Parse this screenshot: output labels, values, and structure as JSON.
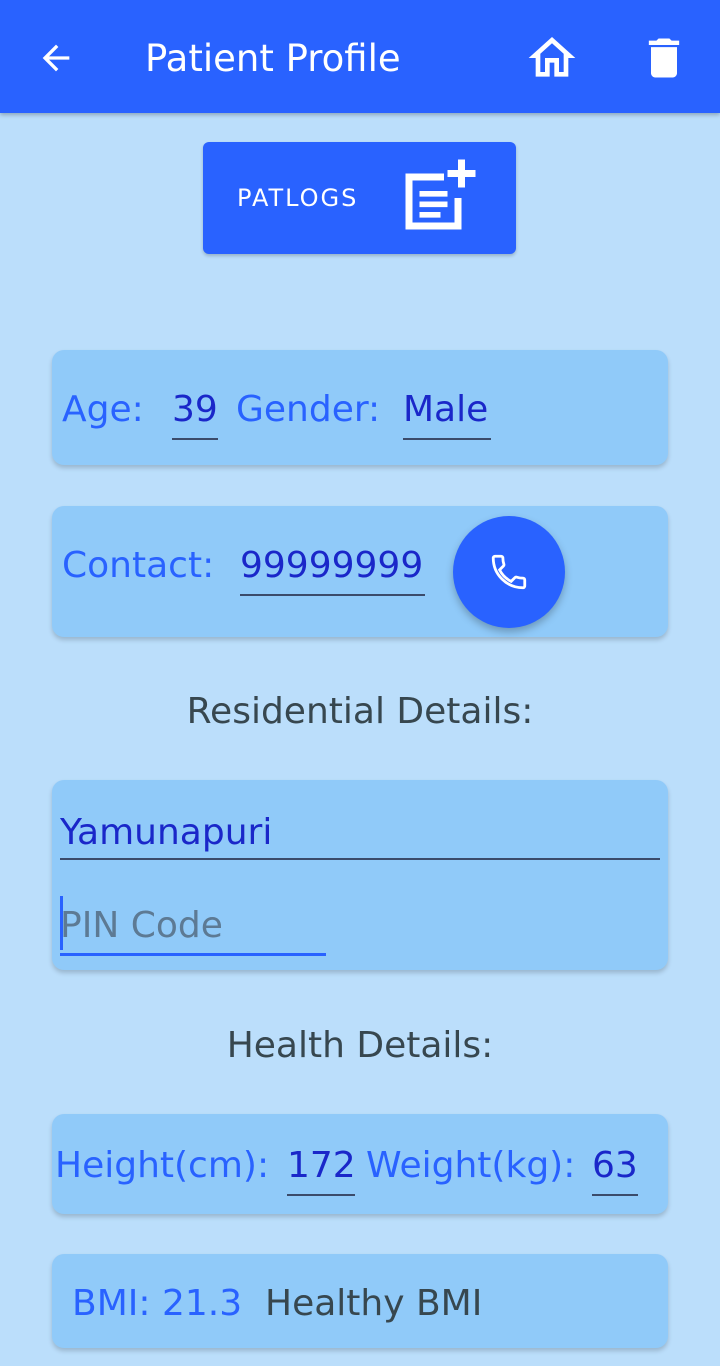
{
  "appbar": {
    "title": "Patient Profile",
    "back_icon": "arrow-left-icon",
    "home_icon": "home-icon",
    "delete_icon": "trash-icon",
    "color": "#2962ff"
  },
  "patlogs": {
    "label": "PATLOGS",
    "icon": "add-note-icon"
  },
  "basic": {
    "age_label": "Age:",
    "age_value": "39",
    "gender_label": "Gender:",
    "gender_value": "Male"
  },
  "contact": {
    "label": "Contact:",
    "value": "99999999",
    "call_icon": "phone-icon"
  },
  "residential": {
    "title": "Residential Details:",
    "address_value": "Yamunapuri",
    "pin_placeholder": "PIN Code"
  },
  "health": {
    "title": "Health Details:",
    "height_label": "Height(cm):",
    "height_value": "172",
    "weight_label": "Weight(kg):",
    "weight_value": "63",
    "bmi_label": "BMI: 21.3",
    "bmi_status": "Healthy BMI"
  },
  "colors": {
    "background": "#bbdefb",
    "card": "#90caf9",
    "accent": "#2962ff",
    "value_text": "#1a27c9"
  }
}
